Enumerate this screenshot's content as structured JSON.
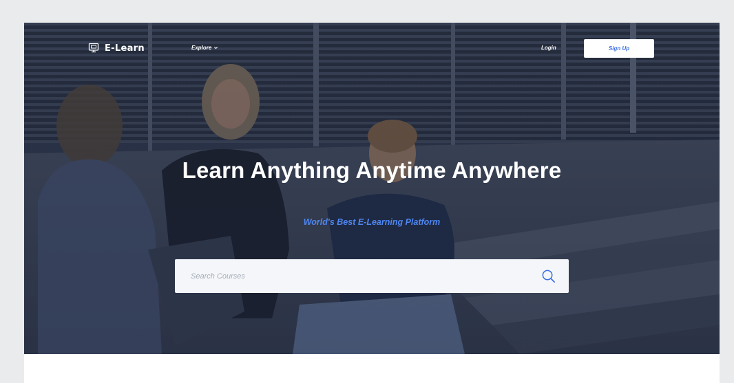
{
  "brand": {
    "name": "E-Learn",
    "icon": "monitor-icon"
  },
  "nav": {
    "explore_label": "Explore",
    "login_label": "Login",
    "signup_label": "Sign Up"
  },
  "hero": {
    "title": "Learn Anything Anytime Anywhere",
    "subtitle": "World's Best E-Learning Platform"
  },
  "search": {
    "placeholder": "Search Courses",
    "value": "",
    "icon": "search-icon"
  },
  "colors": {
    "accent": "#3b6fe0",
    "subtitle": "#4f86f0",
    "page_background": "#eaebec"
  }
}
